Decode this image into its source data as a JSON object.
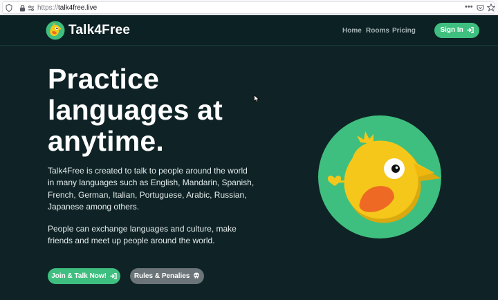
{
  "browser": {
    "url_prefix": "https://",
    "url_host": "talk4free.live",
    "menu_dots": "•••"
  },
  "nav": {
    "brand": "Talk4Free",
    "links": [
      "Home",
      "Rooms",
      "Pricing"
    ],
    "signin_label": "Sign In"
  },
  "hero": {
    "title": "Practice languages at anytime.",
    "paragraph_1": "Talk4Free is created to talk to people around the world in many languages such as English, Mandarin, Spanish, French, German, Italian, Portuguese, Arabic, Russian, Japanese among others.",
    "paragraph_2": "People can exchange languages and culture, make friends and meet up people around the world.",
    "join_label": "Join & Talk Now!",
    "rules_label": "Rules & Penalies"
  },
  "colors": {
    "background": "#0f2326",
    "accent_green": "#3fbf7f",
    "gray_button": "#6b7478",
    "bird_yellow": "#f5c71a",
    "bird_orange": "#ee6a24"
  },
  "icons": {
    "signin": "sign-in-icon",
    "join": "sign-in-icon",
    "rules": "skull-icon",
    "logo": "bird-logo-icon"
  }
}
